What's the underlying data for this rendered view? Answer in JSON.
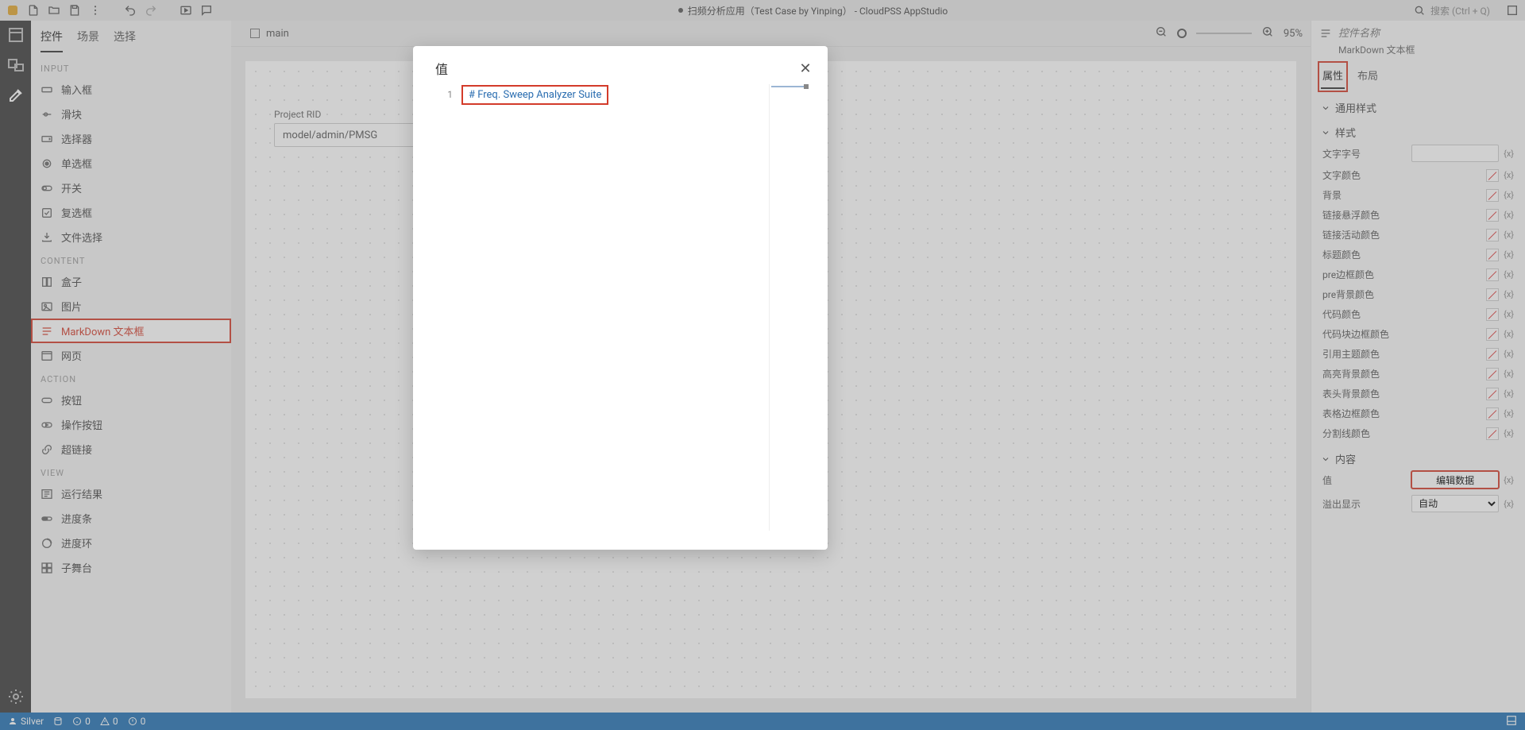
{
  "topbar": {
    "title": "扫频分析应用（Test Case by Yinping） - CloudPSS AppStudio",
    "search_placeholder": "搜索 (Ctrl + Q)"
  },
  "left": {
    "tabs": {
      "controls": "控件",
      "scenes": "场景",
      "select": "选择"
    },
    "sections": {
      "input": "INPUT",
      "content": "CONTENT",
      "action": "ACTION",
      "view": "VIEW"
    },
    "items": {
      "input_box": "输入框",
      "slider": "滑块",
      "selector": "选择器",
      "radio": "单选框",
      "switch": "开关",
      "checkbox": "复选框",
      "file": "文件选择",
      "box": "盒子",
      "image": "图片",
      "markdown": "MarkDown 文本框",
      "webpage": "网页",
      "button": "按钮",
      "action_button": "操作按钮",
      "hyperlink": "超链接",
      "result": "运行结果",
      "progress_bar": "进度条",
      "progress_ring": "进度环",
      "substage": "子舞台"
    }
  },
  "center": {
    "tab_name": "main",
    "zoom": "95%",
    "field_label": "Project RID",
    "field_value": "model/admin/PMSG"
  },
  "right": {
    "name_placeholder": "控件名称",
    "subtype": "MarkDown 文本框",
    "tabs": {
      "props": "属性",
      "layout": "布局"
    },
    "groups": {
      "gen_style": "通用样式",
      "style": "样式",
      "content": "内容"
    },
    "labels": {
      "font_size": "文字字号",
      "text_color": "文字颜色",
      "background": "背景",
      "link_hover": "链接悬浮颜色",
      "link_active": "链接活动颜色",
      "heading_color": "标题颜色",
      "pre_border": "pre边框颜色",
      "pre_bg": "pre背景颜色",
      "code_color": "代码颜色",
      "codeblock_border": "代码块边框颜色",
      "quote_color": "引用主题颜色",
      "highlight_bg": "高亮背景颜色",
      "thead_bg": "表头背景颜色",
      "table_border": "表格边框颜色",
      "divider_color": "分割线颜色",
      "value": "值",
      "overflow": "溢出显示"
    },
    "edit_btn": "编辑数据",
    "overflow_value": "自动",
    "x_btn": "{x}"
  },
  "modal": {
    "title": "值",
    "line_no": "1",
    "code_hash": "# ",
    "code_text": "Freq. Sweep Analyzer Suite"
  },
  "status": {
    "user": "Silver",
    "info": "0",
    "warn": "0",
    "err": "0"
  }
}
